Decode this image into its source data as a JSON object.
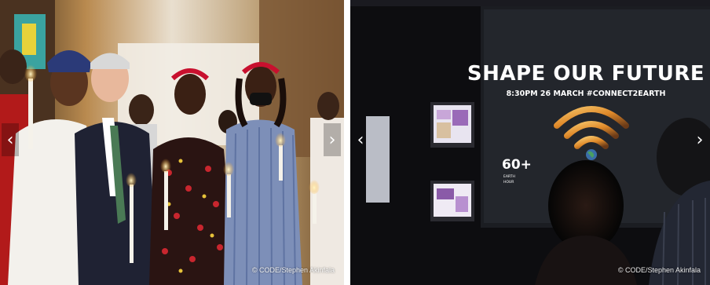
{
  "slides": [
    {
      "credit": "© CODE/Stephen Akinfala",
      "icons": {
        "prev": "chevron-left-icon",
        "next": "chevron-right-icon"
      }
    },
    {
      "credit": "© CODE/Stephen Akinfala",
      "screen": {
        "title": "SHAPE OUR FUTURE",
        "subtitle": "8:30PM 26 MARCH #CONNECT2EARTH",
        "logo_number": "60+",
        "logo_line1": "EARTH",
        "logo_line2": "HOUR"
      },
      "icons": {
        "prev": "chevron-left-icon",
        "next": "chevron-right-icon"
      }
    }
  ],
  "colors": {
    "accent_red": "#c8102e",
    "dark_bg": "#0d0d10"
  }
}
